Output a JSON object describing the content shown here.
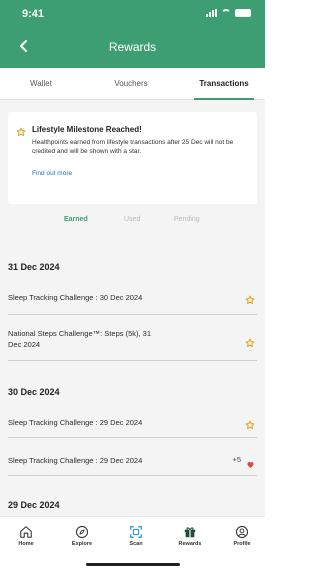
{
  "status_bar": {
    "time": "9:41"
  },
  "header": {
    "title": "Rewards"
  },
  "tabs": [
    {
      "label": "Wallet"
    },
    {
      "label": "Vouchers"
    },
    {
      "label": "Transactions",
      "active": true
    }
  ],
  "milestone_card": {
    "title": "Lifestyle Milestone Reached!",
    "body": "Healthpoints earned from lifestyle transactions after 25 Dec will not be credited and will be shown with a star.",
    "link": "Find out more"
  },
  "filters": [
    {
      "label": "Earned",
      "active": true
    },
    {
      "label": "Used"
    },
    {
      "label": "Pending"
    }
  ],
  "transactions": [
    {
      "date": "31 Dec 2024",
      "items": [
        {
          "label": "Sleep Tracking Challenge : 30 Dec 2024",
          "marker": "star-icon"
        },
        {
          "label": "National Steps Challenge™: Steps (5k), 31 Dec 2024",
          "marker": "star-icon"
        }
      ]
    },
    {
      "date": "30 Dec 2024",
      "items": [
        {
          "label": "Sleep Tracking Challenge : 29 Dec 2024",
          "marker": "star-icon"
        },
        {
          "label": "Sleep Tracking Challenge : 29 Dec 2024",
          "points": "+5",
          "marker": "heart-icon"
        }
      ]
    },
    {
      "date": "29 Dec 2024",
      "items": []
    }
  ],
  "bottom_nav": [
    {
      "label": "Home",
      "icon": "home-icon"
    },
    {
      "label": "Explore",
      "icon": "compass-icon"
    },
    {
      "label": "Scan",
      "icon": "scan-icon"
    },
    {
      "label": "Rewards",
      "icon": "gift-icon",
      "active": true
    },
    {
      "label": "Profile",
      "icon": "profile-icon"
    }
  ],
  "colors": {
    "brand": "#3d9e72",
    "star": "#e0a21b",
    "heart": "#e0463c",
    "link": "#1b6fcf"
  }
}
